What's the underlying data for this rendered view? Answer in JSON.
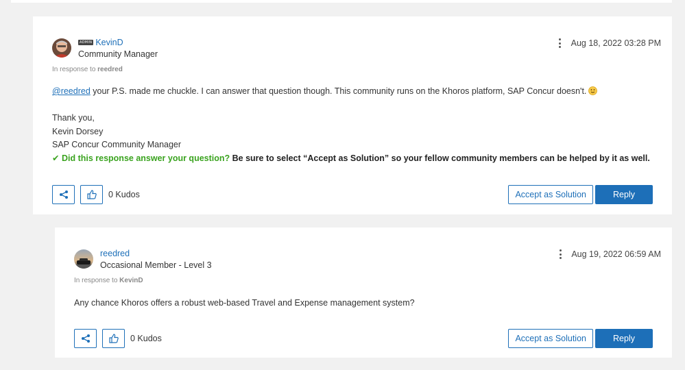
{
  "colors": {
    "link": "#1d6fb8",
    "green": "#3aa31f",
    "page_bg": "#f1f1f1"
  },
  "posts": [
    {
      "author": "KevinD",
      "badge": "ADMIN",
      "rank": "Community Manager",
      "in_response_prefix": "In response to",
      "in_response_to": "reedred",
      "date": "Aug 18, 2022 03:28 PM",
      "mention": "@reedred",
      "body_line1": " your P.S. made me chuckle. I can answer that question though. This community runs on the Khoros platform, SAP Concur doesn't.",
      "signoff": "Thank you,",
      "sig_name": "Kevin Dorsey",
      "sig_title": "SAP Concur Community Manager",
      "accept_check": "✔",
      "accept_question": "Did this response answer your question?",
      "accept_text": " Be sure to select “Accept as Solution” so your fellow community members can be helped by it as well.",
      "kudos": "0 Kudos",
      "accept_label": "Accept as Solution",
      "reply_label": "Reply"
    },
    {
      "author": "reedred",
      "rank": "Occasional Member - Level 3",
      "in_response_prefix": "In response to",
      "in_response_to": "KevinD",
      "date": "Aug 19, 2022 06:59 AM",
      "body": "Any chance Khoros offers a robust web-based Travel and Expense management system?",
      "kudos": "0 Kudos",
      "accept_label": "Accept as Solution",
      "reply_label": "Reply"
    }
  ],
  "icons": [
    "share-icon",
    "thumbs-up-icon",
    "kebab-menu-icon",
    "smiley-icon"
  ]
}
